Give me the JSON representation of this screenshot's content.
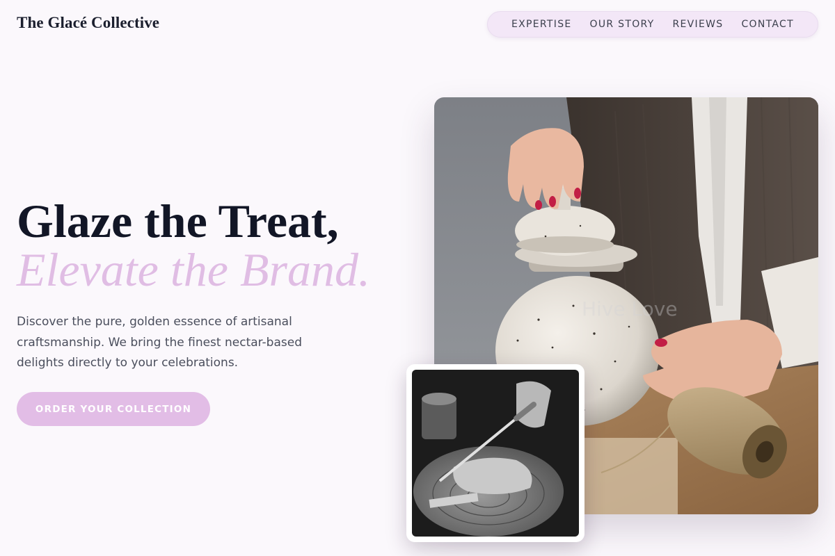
{
  "header": {
    "brand": "The Glacé Collective",
    "nav": [
      {
        "label": "EXPERTISE"
      },
      {
        "label": "OUR STORY"
      },
      {
        "label": "REVIEWS"
      },
      {
        "label": "CONTACT"
      }
    ]
  },
  "hero": {
    "headline_line1": "Glaze the Treat,",
    "headline_line2": "Elevate the Brand.",
    "intro": "Discover the pure, golden essence of artisanal craftsmanship. We bring the finest nectar-based delights directly to your celebrations.",
    "cta_label": "ORDER YOUR COLLECTION"
  },
  "media": {
    "main_photo_overlay_text": "Hive Love"
  },
  "colors": {
    "background": "#fbf8fc",
    "accent_lilac": "#e2bde6",
    "nav_pill": "#f3e7f7",
    "heading_dark": "#121626"
  },
  "icons": {
    "main_photo": "ceramic-honey-jar-photo",
    "inset_photo": "woodworking-hands-photo"
  }
}
